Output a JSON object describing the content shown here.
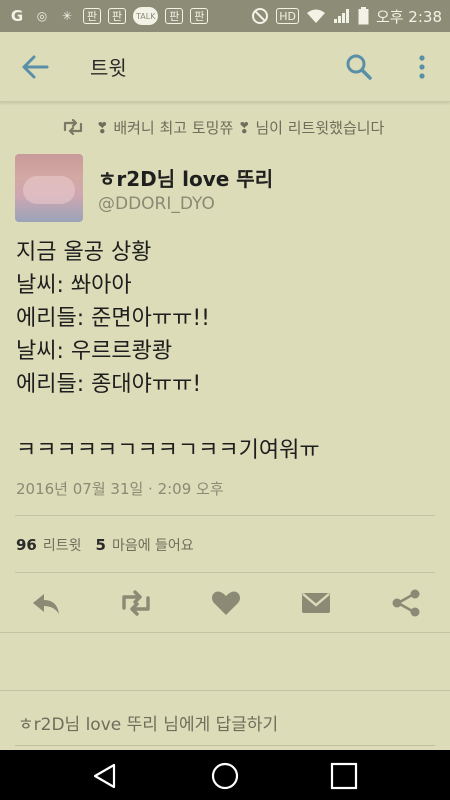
{
  "status_bar": {
    "left_icons": [
      "G",
      "◎",
      "✳",
      "판",
      "판",
      "TALK",
      "판",
      "판"
    ],
    "right_icons": [
      "no-disturb-icon",
      "hd-icon",
      "wifi-icon",
      "signal-icon",
      "battery-icon"
    ],
    "hd_label": "HD",
    "time": "오후 2:38"
  },
  "app_bar": {
    "title": "트윗"
  },
  "retweet_context": {
    "text": "❣ 배켜니 최고 토밍쮸 ❣ 님이 리트윗했습니다"
  },
  "author": {
    "name": "ㅎr2D님 love 뚜리",
    "handle": "@DDORI_DYO"
  },
  "tweet": {
    "lines": [
      "지금 올공 상황",
      "날씨: 쏴아아",
      "에리들: 준면아ㅠㅠ!!",
      "날씨: 우르르쾅쾅",
      "에리들: 종대야ㅠㅠ!",
      "",
      "ㅋㅋㅋㅋㅋㄱㅋㅋㄱㅋㅋ기여워ㅠ"
    ],
    "timestamp": "2016년 07월 31일 · 2:09 오후"
  },
  "stats": {
    "retweets_count": "96",
    "retweets_label": "리트윗",
    "likes_count": "5",
    "likes_label": "마음에 들어요"
  },
  "reply_bar": {
    "placeholder": "ㅎr2D님 love 뚜리 님에게 답글하기"
  },
  "colors": {
    "background": "#dcdcb8",
    "status_bar": "#8c8c77",
    "accent": "#5a8fa8",
    "icon_gray": "#8a8a75"
  }
}
